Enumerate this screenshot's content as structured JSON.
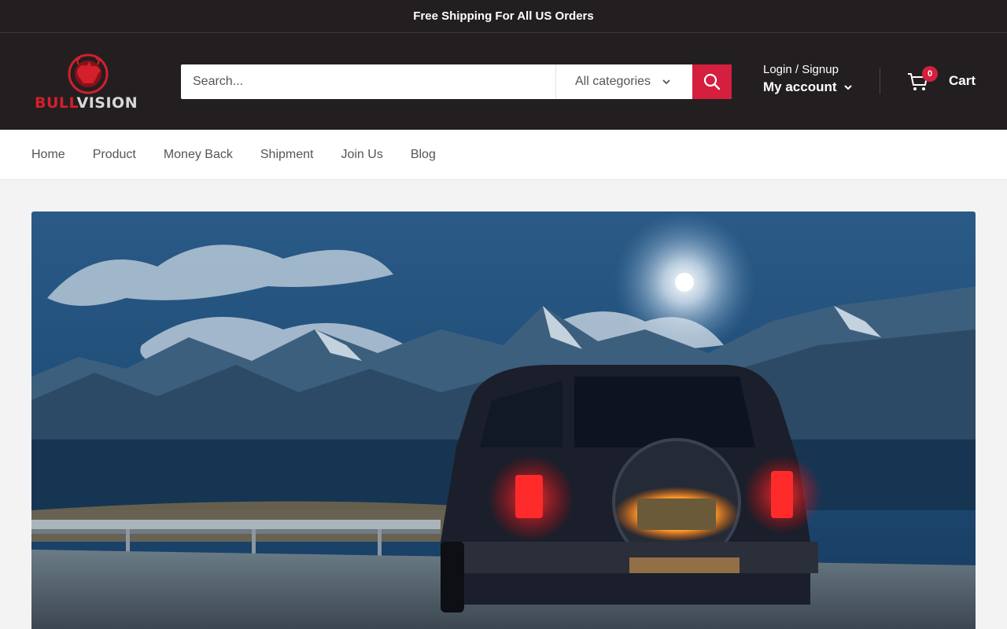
{
  "announcement": {
    "text": "Free Shipping For All US Orders"
  },
  "header": {
    "logo": {
      "part1": "BULL",
      "part2": "VISION"
    },
    "search": {
      "placeholder": "Search...",
      "category": "All categories"
    },
    "account": {
      "login": "Login / Signup",
      "label": "My account"
    },
    "cart": {
      "count": "0",
      "label": "Cart"
    }
  },
  "nav": {
    "items": [
      {
        "label": "Home"
      },
      {
        "label": "Product"
      },
      {
        "label": "Money Back"
      },
      {
        "label": "Shipment"
      },
      {
        "label": "Join Us"
      },
      {
        "label": "Blog"
      }
    ]
  },
  "colors": {
    "header_bg": "#231f20",
    "accent": "#d41f3f",
    "page_bg": "#f3f3f3"
  }
}
